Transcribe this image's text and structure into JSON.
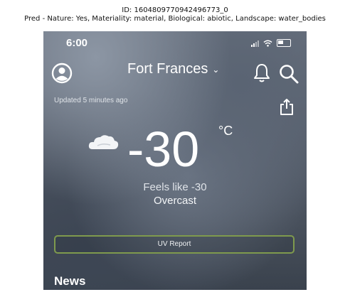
{
  "caption": {
    "line1": "ID: 1604809770942496773_0",
    "line2": "Pred - Nature: Yes, Materiality: material, Biological: abiotic, Landscape: water_bodies"
  },
  "status_bar": {
    "time": "6:00"
  },
  "header": {
    "city": "Fort Frances",
    "chevron": "⌄"
  },
  "updated_text": "Updated 5 minutes ago",
  "current": {
    "temperature": "-30",
    "unit": "°C",
    "feels_like": "Feels like -30",
    "condition": "Overcast"
  },
  "uv_button_label": "UV Report",
  "news_heading": "News",
  "icons": [
    "profile-icon",
    "bell-icon",
    "search-icon",
    "share-icon",
    "cloud-icon",
    "signal-icon",
    "wifi-icon",
    "battery-icon"
  ],
  "colors": {
    "uv_border": "#7f9a4d",
    "text": "#ffffff"
  }
}
